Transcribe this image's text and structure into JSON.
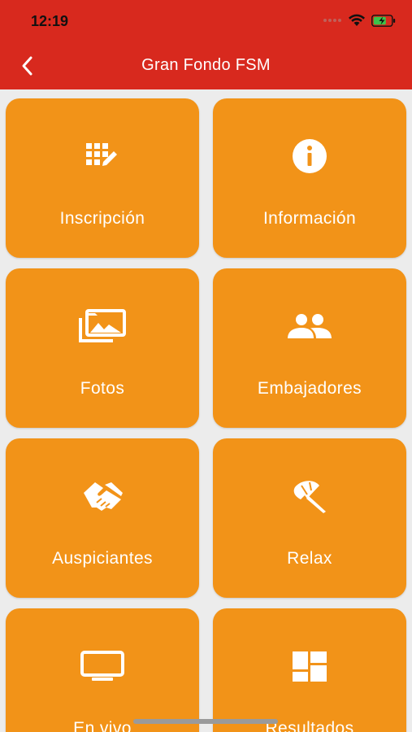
{
  "status_bar": {
    "time": "12:19"
  },
  "header": {
    "title": "Gran Fondo FSM",
    "back_icon": "chevron-left-icon"
  },
  "tiles": [
    {
      "label": "Inscripción",
      "icon": "grid-edit-icon"
    },
    {
      "label": "Información",
      "icon": "info-icon"
    },
    {
      "label": "Fotos",
      "icon": "photo-library-icon"
    },
    {
      "label": "Embajadores",
      "icon": "people-icon"
    },
    {
      "label": "Auspiciantes",
      "icon": "handshake-icon"
    },
    {
      "label": "Relax",
      "icon": "beach-umbrella-icon"
    },
    {
      "label": "En vivo",
      "icon": "tv-icon"
    },
    {
      "label": "Resultados",
      "icon": "dashboard-icon"
    }
  ],
  "colors": {
    "header": "#d8291e",
    "tile": "#f29318",
    "background": "#ececec"
  }
}
